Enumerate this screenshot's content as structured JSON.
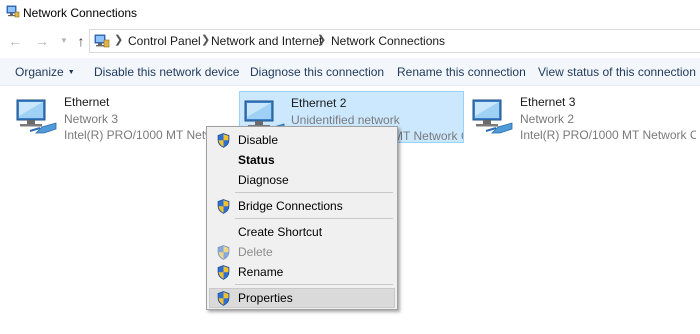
{
  "window": {
    "title": "Network Connections"
  },
  "address": {
    "crumbs": [
      "Control Panel",
      "Network and Internet",
      "Network Connections"
    ]
  },
  "toolbar": {
    "organize": "Organize",
    "disable": "Disable this network device",
    "diagnose": "Diagnose this connection",
    "rename": "Rename this connection",
    "view_status": "View status of this connection"
  },
  "connections": [
    {
      "name": "Ethernet",
      "status": "Network  3",
      "device": "Intel(R) PRO/1000 MT Network C..."
    },
    {
      "name": "Ethernet 2",
      "status": "Unidentified network",
      "device": "Intel(R) PRO/1000 MT Network C..."
    },
    {
      "name": "Ethernet 3",
      "status": "Network  2",
      "device": "Intel(R) PRO/1000 MT Network C..."
    }
  ],
  "context_menu": {
    "items": [
      {
        "label": "Disable",
        "icon": "shield-icon"
      },
      {
        "label": "Status"
      },
      {
        "label": "Diagnose"
      },
      {
        "label": "Bridge Connections",
        "icon": "shield-icon"
      },
      {
        "label": "Create Shortcut"
      },
      {
        "label": "Delete",
        "icon": "shield-icon"
      },
      {
        "label": "Rename",
        "icon": "shield-icon"
      },
      {
        "label": "Properties",
        "icon": "shield-icon"
      }
    ]
  },
  "colors": {
    "selection_bg": "#cce8ff",
    "command_text": "#1e395b",
    "menu_bg": "#f0f0f0"
  }
}
